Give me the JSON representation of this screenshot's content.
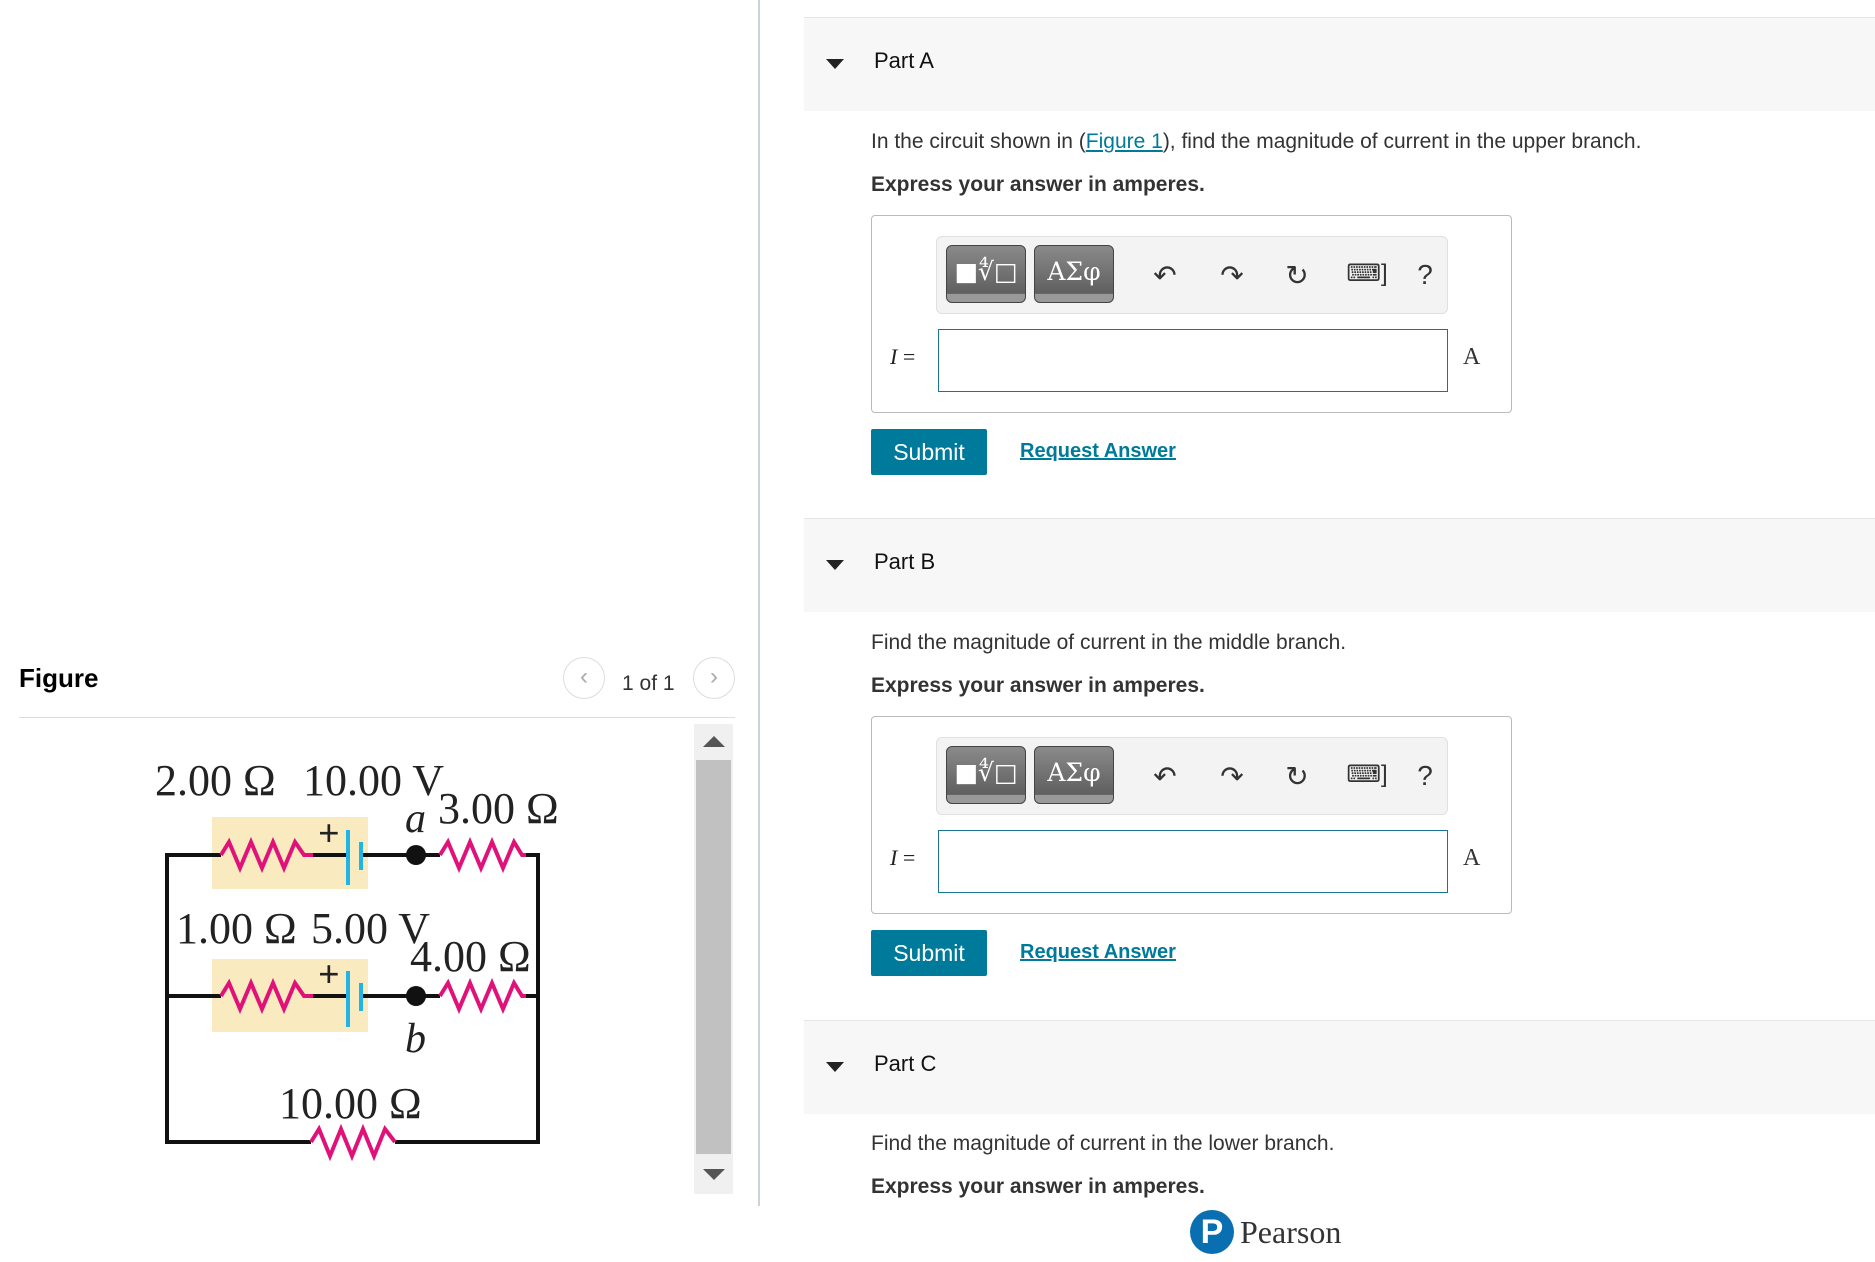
{
  "figure_panel": {
    "title": "Figure",
    "counter": "1 of 1",
    "prev_icon": "chevron-left-icon",
    "next_icon": "chevron-right-icon",
    "circuit": {
      "labels": {
        "r_top_left": "2.00 Ω",
        "v_top": "10.00 V",
        "node_a": "a",
        "r_top_right": "3.00 Ω",
        "r_mid_left": "1.00 Ω",
        "v_mid": "5.00 V",
        "r_mid_right": "4.00 Ω",
        "node_b": "b",
        "r_bottom": "10.00 Ω",
        "plus": "+"
      },
      "colors": {
        "resistor": "#e0127a",
        "battery": "#1fb5e6",
        "highlight": "#faeac0",
        "wire": "#111111"
      }
    }
  },
  "parts": [
    {
      "title": "Part A",
      "question_pre": "In the circuit shown in (",
      "question_link": "Figure 1",
      "question_post": "), find the magnitude of current in the upper branch.",
      "instruction": "Express your answer in amperes.",
      "input_label_var": "I",
      "input_label_eq": " =",
      "input_value": "",
      "unit": "A",
      "submit": "Submit",
      "request": "Request Answer"
    },
    {
      "title": "Part B",
      "question": "Find the magnitude of current in the middle branch.",
      "instruction": "Express your answer in amperes.",
      "input_label_var": "I",
      "input_label_eq": " =",
      "input_value": "",
      "unit": "A",
      "submit": "Submit",
      "request": "Request Answer"
    },
    {
      "title": "Part C",
      "question": "Find the magnitude of current in the lower branch.",
      "instruction": "Express your answer in amperes."
    }
  ],
  "toolbar": {
    "template_btn": "■∜□",
    "symbols_btn": "ΑΣφ",
    "undo": "↶",
    "redo": "↷",
    "reset": "↻",
    "keyboard": "⌨]",
    "help": "?"
  },
  "brand": {
    "logo_letter": "P",
    "name": "Pearson",
    "color": "#0a6fb0"
  },
  "accent": "#007a9a"
}
